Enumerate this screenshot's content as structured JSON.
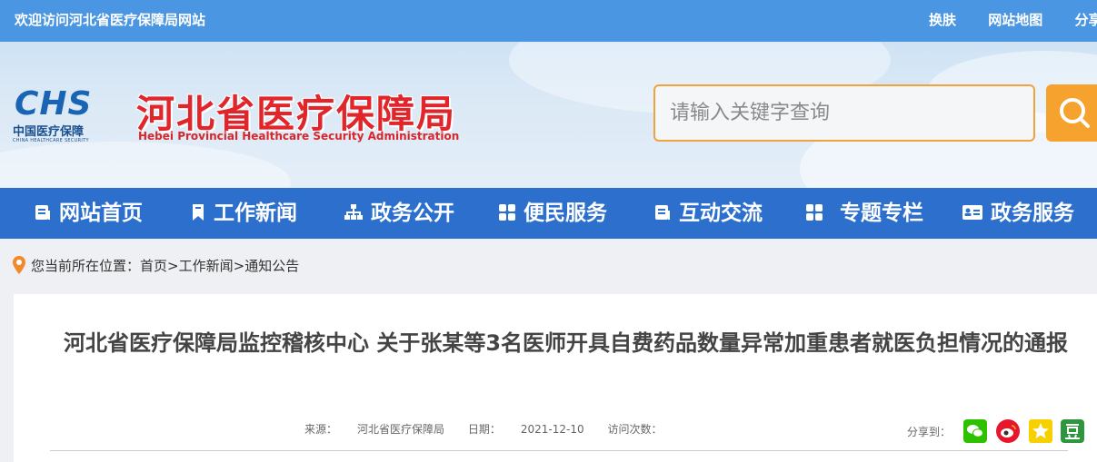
{
  "topbar": {
    "welcome": "欢迎访问河北省医疗保障局网站",
    "links": [
      "换肤",
      "网站地图",
      "分享"
    ]
  },
  "header": {
    "logo_abbr": "CHS",
    "logo_cn": "中国医疗保障",
    "logo_en": "CHINA HEALTHCARE SECURITY",
    "site_title": "河北省医疗保障局",
    "site_subtitle": "Hebei Provincial Healthcare Security Administration",
    "search_placeholder": "请输入关键字查询"
  },
  "nav": {
    "items": [
      {
        "label": "网站首页",
        "icon": "document-icon"
      },
      {
        "label": "工作新闻",
        "icon": "bookmark-icon"
      },
      {
        "label": "政务公开",
        "icon": "sitemap-icon"
      },
      {
        "label": "便民服务",
        "icon": "grid-icon"
      },
      {
        "label": "互动交流",
        "icon": "document-icon"
      },
      {
        "label": "专题专栏",
        "icon": "grid-icon"
      },
      {
        "label": "政务服务",
        "icon": "id-card-icon"
      }
    ]
  },
  "breadcrumb": {
    "prefix": "您当前所在位置：",
    "items": [
      "首页",
      "工作新闻",
      "通知公告"
    ],
    "separator": ">"
  },
  "article": {
    "title": "河北省医疗保障局监控稽核中心 关于张某等3名医师开具自费药品数量异常加重患者就医负担情况的通报",
    "source_label": "来源：",
    "source": "河北省医疗保障局",
    "date_label": "日期：",
    "date": "2021-12-10",
    "visits_label": "访问次数：",
    "share_label": "分享到："
  },
  "colors": {
    "topbar": "#4a96e2",
    "nav": "#2c6fcc",
    "accent": "#f5a22e",
    "title_red": "#e0262a"
  }
}
